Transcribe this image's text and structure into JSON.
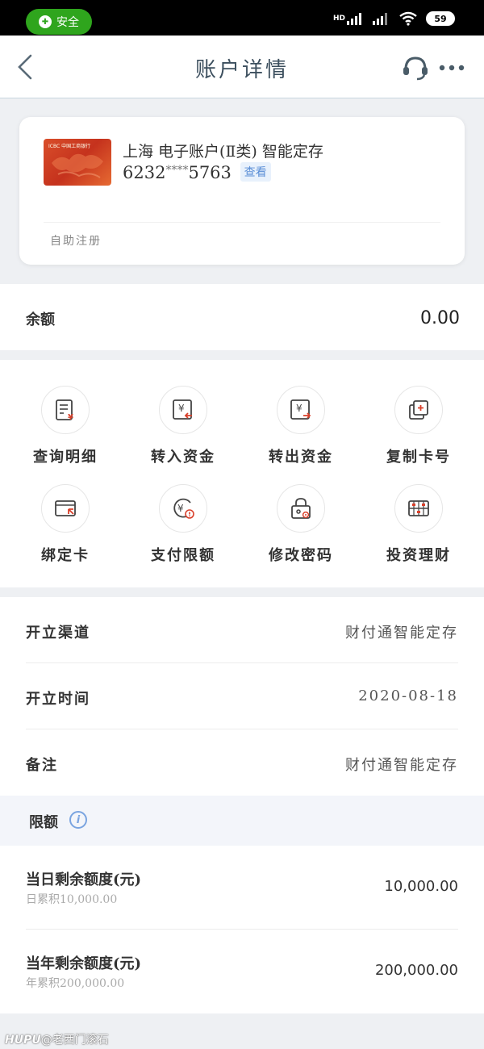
{
  "status_bar": {
    "safe_label": "安全",
    "network": "HD",
    "battery": "59"
  },
  "nav": {
    "title": "账户详情"
  },
  "card": {
    "bank_logo_text": "ICBC 中国工商银行",
    "title": "上海 电子账户(Ⅱ类) 智能定存",
    "number_prefix": "6232",
    "number_mask": "****",
    "number_suffix": "5763",
    "view_label": "查看",
    "footer": "自助注册"
  },
  "balance": {
    "label": "余额",
    "value": "0.00"
  },
  "actions": [
    {
      "label": "查询明细"
    },
    {
      "label": "转入资金"
    },
    {
      "label": "转出资金"
    },
    {
      "label": "复制卡号"
    },
    {
      "label": "绑定卡"
    },
    {
      "label": "支付限额"
    },
    {
      "label": "修改密码"
    },
    {
      "label": "投资理财"
    }
  ],
  "info": [
    {
      "key": "开立渠道",
      "value": "财付通智能定存"
    },
    {
      "key": "开立时间",
      "value": "2020-08-18"
    },
    {
      "key": "备注",
      "value": "财付通智能定存"
    }
  ],
  "limits": {
    "title": "限额",
    "items": [
      {
        "key": "当日剩余额度(元)",
        "sub": "日累积10,000.00",
        "value": "10,000.00"
      },
      {
        "key": "当年剩余额度(元)",
        "sub": "年累积200,000.00",
        "value": "200,000.00"
      }
    ]
  },
  "watermark": {
    "brand": "HUPU",
    "user": "@老西门滚石"
  },
  "colors": {
    "accent_green": "#2fa51d",
    "link_blue": "#5a8ed6",
    "icon_red": "#d9402b",
    "nav_title": "#3c4f5e"
  }
}
